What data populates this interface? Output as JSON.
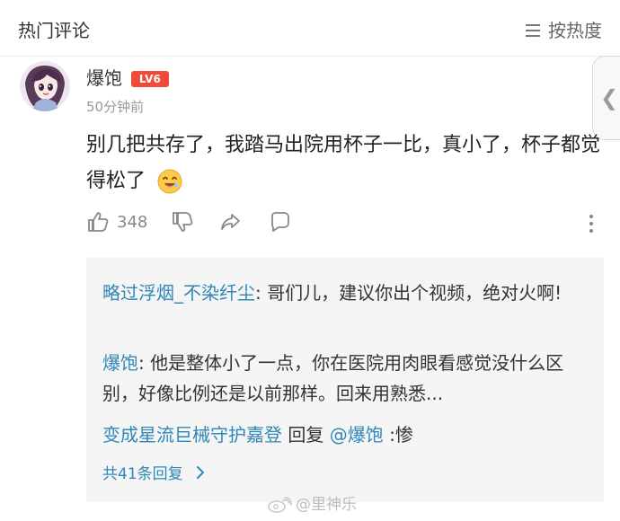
{
  "header": {
    "title": "热门评论",
    "sort_label": "按热度"
  },
  "comment": {
    "username": "爆饱",
    "level_badge": "LV6",
    "timestamp": "50分钟前",
    "text": "别几把共存了，我踏马出院用杯子一比，真小了，杯子都觉得松了",
    "like_count": "348",
    "icons": {
      "like": "thumbs-up-icon",
      "dislike": "thumbs-down-icon",
      "share": "share-icon",
      "reply": "reply-icon",
      "more": "more-icon",
      "emoji": "laughing-emoji-icon"
    }
  },
  "replies": [
    {
      "user": "略过浮烟_不染纤尘",
      "separator": ": ",
      "text": "哥们儿，建议你出个视频，绝对火啊!"
    },
    {
      "user": "爆饱",
      "separator": ": ",
      "text": "他是整体小了一点，你在医院用肉眼看感觉没什么区别，好像比例还是以前那样。回来用熟悉..."
    },
    {
      "user": "变成星流巨械守护嘉登",
      "middle": " 回复 ",
      "mention": "@爆饱",
      "separator": " :",
      "text": "惨"
    }
  ],
  "more_replies": {
    "label": "共41条回复"
  },
  "watermark": {
    "text": "@里神乐"
  },
  "colors": {
    "link": "#2f87b8",
    "badge": "#f24a38",
    "panel": "#f5f5f5"
  }
}
